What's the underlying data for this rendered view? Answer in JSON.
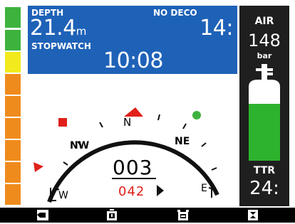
{
  "level_bar": {
    "colors": [
      "#3db23d",
      "#3db23d",
      "#f2ea1c",
      "#ef8b1c",
      "#ef8b1c",
      "#ef8b1c",
      "#ef8b1c",
      "#ef8b1c",
      "#ef8b1c"
    ]
  },
  "info_panel": {
    "depth_label": "DEPTH",
    "depth_value": "21.4",
    "depth_unit": "m",
    "no_deco_label": "NO DECO",
    "no_deco_value": "14:",
    "stopwatch_label": "STOPWATCH",
    "stopwatch_value": "10:08",
    "background": "#1e62b8"
  },
  "air_panel": {
    "air_label": "AIR",
    "air_value": "148",
    "air_unit": "bar",
    "ttr_label": "TTR",
    "ttr_value": "24:",
    "tank_fill_color": "#2db32d"
  },
  "compass": {
    "cardinal_labels": {
      "nw": "NW",
      "n": "N",
      "ne": "NE",
      "w": "W",
      "e": "E"
    },
    "heading": "003",
    "bearing": "042",
    "heading_marker_color": "#e0201a",
    "bearing_marker_color": "#e0201a",
    "waypoint_color": "#3db23d"
  },
  "bottom_bar": {
    "buttons": [
      {
        "icon": "back-icon"
      },
      {
        "icon": "stopwatch-icon"
      },
      {
        "icon": "alarm-clock-icon"
      },
      {
        "icon": "hourglass-icon"
      }
    ]
  }
}
